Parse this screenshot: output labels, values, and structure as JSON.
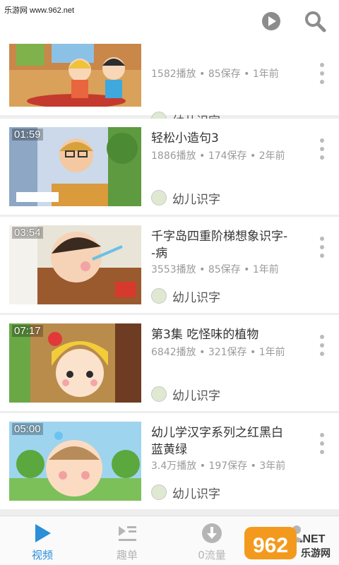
{
  "watermark": "乐游网 www.962.net",
  "colors": {
    "accent": "#2a8ed8",
    "meta": "#9a9a9a",
    "tab_inactive": "#b5b5b5"
  },
  "top_icons": [
    "play-circle-icon",
    "search-icon"
  ],
  "videos": [
    {
      "title": "",
      "duration": "",
      "plays": "1582播放",
      "saves": "85保存",
      "age": "1年前",
      "author": "幼儿识字"
    },
    {
      "title": "轻松小造句3",
      "duration": "01:59",
      "plays": "1886播放",
      "saves": "174保存",
      "age": "2年前",
      "author": "幼儿识字"
    },
    {
      "title": "千字岛四重阶梯想象识字-\n-病",
      "duration": "03:54",
      "plays": "3553播放",
      "saves": "85保存",
      "age": "1年前",
      "author": "幼儿识字"
    },
    {
      "title": "第3集 吃怪味的植物",
      "duration": "07:17",
      "plays": "6842播放",
      "saves": "321保存",
      "age": "1年前",
      "author": "幼儿识字"
    },
    {
      "title": "幼儿学汉字系列之红黑白\n蓝黄绿",
      "duration": "05:00",
      "plays": "3.4万播放",
      "saves": "197保存",
      "age": "3年前",
      "author": "幼儿识字"
    }
  ],
  "tabs": [
    {
      "label": "视频",
      "icon": "play-triangle-icon",
      "active": true
    },
    {
      "label": "趣单",
      "icon": "playlist-icon",
      "active": false
    },
    {
      "label": "0流量",
      "icon": "download-icon",
      "active": false
    },
    {
      "label": "",
      "icon": "profile-icon",
      "active": false
    }
  ],
  "logo": {
    "text": "962",
    "suffix": ".NET",
    "caption": "乐游网"
  }
}
